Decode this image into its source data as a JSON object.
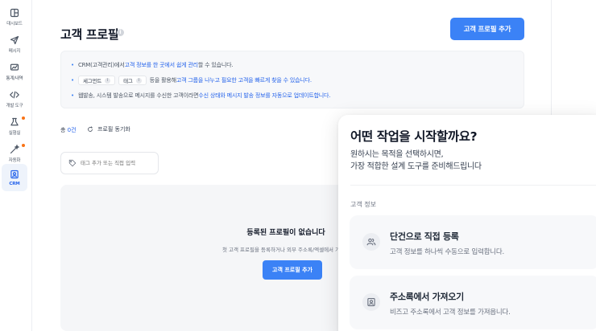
{
  "sidebar": {
    "items": [
      {
        "label": "대시보드",
        "icon": "dashboard-icon"
      },
      {
        "label": "메시지",
        "icon": "send-icon"
      },
      {
        "label": "통계/내역",
        "icon": "stats-icon"
      },
      {
        "label": "개발 도구",
        "icon": "code-icon"
      },
      {
        "label": "실험실",
        "icon": "flask-icon",
        "badge": true
      },
      {
        "label": "자동화",
        "icon": "wand-icon",
        "badge": true
      },
      {
        "label": "CRM",
        "icon": "contact-icon",
        "active": true
      }
    ]
  },
  "page": {
    "title": "고객 프로필",
    "info_icon": "i",
    "add_button": "고객 프로필 추가"
  },
  "info_box": {
    "line1": {
      "pre": "CRM(고객관리)에서 ",
      "highlight": "고객 정보를 한 곳에서 쉽게 관리",
      "post": "할 수 있습니다."
    },
    "line2": {
      "chip1": "세그먼트",
      "chip2": "태그",
      "chip_icon": "i",
      "pre": "등을 활용해 ",
      "highlight": "고객 그룹을 나누고 필요한 고객을 빠르게 찾을 수 있습니다."
    },
    "line3": {
      "pre": "웹발송, 시스템 발송으로 메시지를 수신한 고객이라면 ",
      "highlight": "수신 상태와 메시지 발송 정보를 자동으로 업데이트합니다."
    }
  },
  "list": {
    "count_prefix": "총 ",
    "count": "0건",
    "sync_label": "프로필 동기화",
    "tag_placeholder": "태그 추가 또는 직접 입력"
  },
  "empty": {
    "title": "등록된 프로필이 없습니다",
    "desc": "첫 고객 프로필을 등록하거나 외부 주소록/엑셀에서 가져와",
    "button": "고객 프로필 추가"
  },
  "popover": {
    "title": "어떤 작업을 시작할까요?",
    "subtitle_line1": "원하시는 목적을 선택하시면,",
    "subtitle_line2": "가장 적합한 설계 도구를 준비해드립니다",
    "section": "고객 정보",
    "options": [
      {
        "title": "단건으로 직접 등록",
        "desc": "고객 정보를 하나씩 수동으로 입력합니다.",
        "icon": "users-icon"
      },
      {
        "title": "주소록에서 가져오기",
        "desc": "비즈고 주소록에서 고객 정보를 가져옵니다.",
        "icon": "contact-card-icon"
      }
    ]
  },
  "colors": {
    "accent": "#3b82f6",
    "highlight": "#2563eb",
    "badge": "#f97316"
  }
}
